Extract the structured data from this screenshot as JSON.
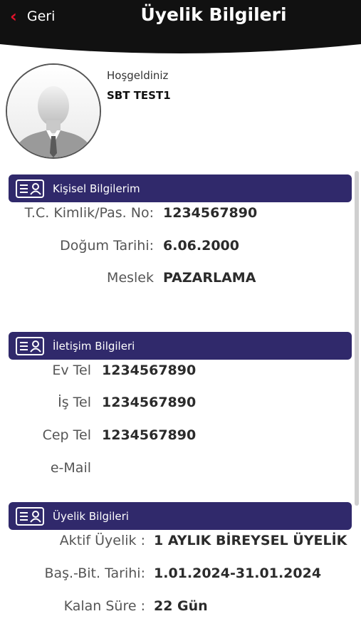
{
  "header": {
    "back_label": "Geri",
    "title": "Üyelik Bilgileri"
  },
  "profile": {
    "welcome": "Hoşgeldiniz",
    "name": "SBT TEST1"
  },
  "personal": {
    "section_title": "Kişisel Bilgilerim",
    "fields": [
      {
        "label": "T.C. Kimlik/Pas. No:",
        "value": "1234567890"
      },
      {
        "label": "Doğum Tarihi:",
        "value": "6.06.2000"
      },
      {
        "label": "Meslek",
        "value": "PAZARLAMA"
      }
    ]
  },
  "contact": {
    "section_title": "İletişim Bilgileri",
    "fields": [
      {
        "label": "Ev Tel",
        "value": "1234567890"
      },
      {
        "label": "İş Tel",
        "value": "1234567890"
      },
      {
        "label": "Cep Tel",
        "value": "1234567890"
      },
      {
        "label": "e-Mail",
        "value": ""
      }
    ]
  },
  "membership": {
    "section_title": "Üyelik Bilgileri",
    "fields": [
      {
        "label": "Aktif Üyelik :",
        "value": "1 AYLIK BİREYSEL ÜYELİK"
      },
      {
        "label": "Baş.-Bit. Tarihi:",
        "value": "1.01.2024-31.01.2024"
      },
      {
        "label": "Kalan Süre :",
        "value": "22 Gün"
      }
    ]
  },
  "colors": {
    "header_bg": "#111111",
    "accent_red": "#e2122a",
    "section_bar": "#30296b"
  }
}
